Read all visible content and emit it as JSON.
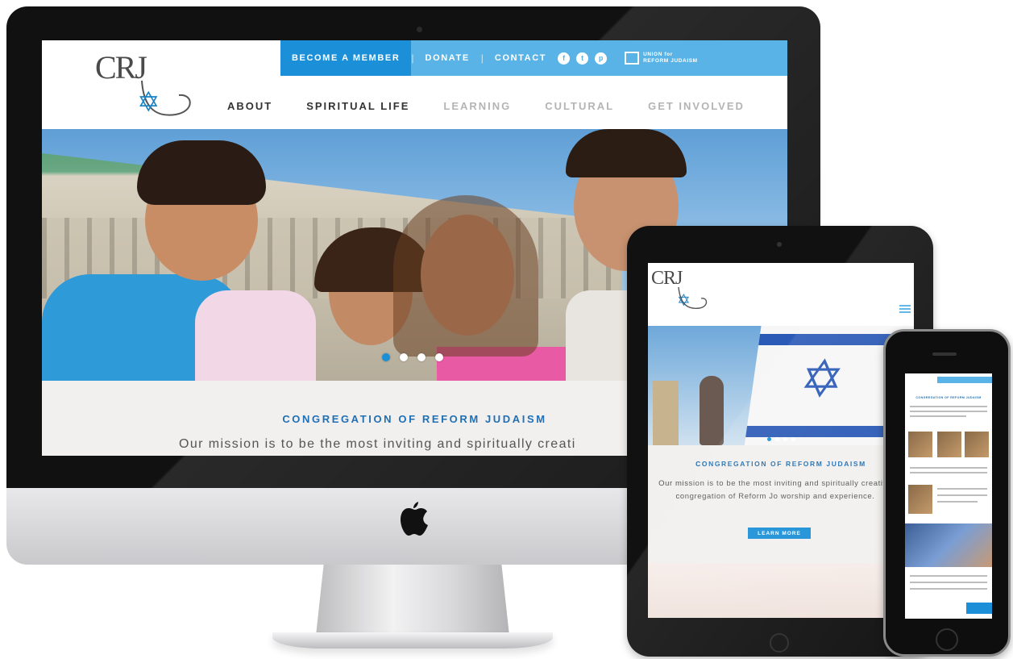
{
  "desktop": {
    "logo_text": "CRJ",
    "topbar": {
      "member": "BECOME A MEMBER",
      "donate": "DONATE",
      "contact": "CONTACT",
      "social_icons": [
        "facebook-icon",
        "twitter-icon",
        "pinterest-icon"
      ],
      "urj_line1": "UNION for",
      "urj_line2": "REFORM JUDAISM"
    },
    "nav": [
      "ABOUT",
      "SPIRITUAL LIFE",
      "LEARNING",
      "CULTURAL",
      "GET INVOLVED"
    ],
    "carousel": {
      "slides": 4,
      "active": 0
    },
    "mission_heading": "CONGREGATION OF REFORM JUDAISM",
    "mission_text": "Our mission is to be the most inviting and spiritually creati"
  },
  "tablet": {
    "logo_text": "CRJ",
    "mission_heading": "CONGREGATION OF REFORM JUDAISM",
    "mission_text": "Our mission is to be the most inviting and spiritually creative congregation of Reform Jo worship and experience.",
    "button": "LEARN MORE"
  },
  "phone": {
    "heading": "CONGREGATION OF REFORM JUDAISM"
  },
  "colors": {
    "primary_blue": "#1b8fd8",
    "light_blue": "#5ab3e6",
    "heading_blue": "#1f6fb5"
  }
}
